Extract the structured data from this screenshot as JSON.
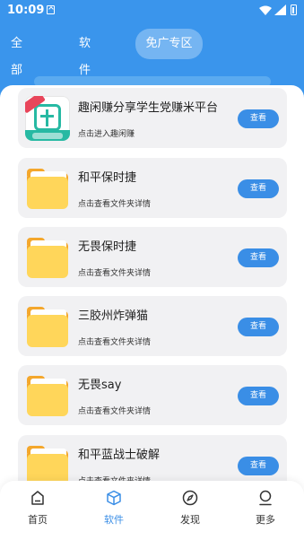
{
  "status_bar": {
    "time": "10:09"
  },
  "tabs": [
    {
      "label": "全部资源",
      "active": false
    },
    {
      "label": "软件库端",
      "active": false
    },
    {
      "label": "免广专区",
      "active": true
    }
  ],
  "cards": [
    {
      "title": "趣闲赚分享学生党赚米平台",
      "subtitle": "点击进入趣闲赚",
      "button": "查看",
      "icon": "app-icon"
    },
    {
      "title": "和平保时捷",
      "subtitle": "点击查看文件夹详情",
      "button": "查看",
      "icon": "folder-icon"
    },
    {
      "title": "无畏保时捷",
      "subtitle": "点击查看文件夹详情",
      "button": "查看",
      "icon": "folder-icon"
    },
    {
      "title": "三胶州炸弹猫",
      "subtitle": "点击查看文件夹详情",
      "button": "查看",
      "icon": "folder-icon"
    },
    {
      "title": "无畏say",
      "subtitle": "点击查看文件夹详情",
      "button": "查看",
      "icon": "folder-icon"
    },
    {
      "title": "和平蓝战士破解",
      "subtitle": "点击查看文件夹详情",
      "button": "查看",
      "icon": "folder-icon"
    }
  ],
  "bottom_nav": [
    {
      "label": "首页",
      "icon": "home-icon",
      "active": false
    },
    {
      "label": "软件",
      "icon": "box-icon",
      "active": true
    },
    {
      "label": "发现",
      "icon": "compass-icon",
      "active": false
    },
    {
      "label": "更多",
      "icon": "user-icon",
      "active": false
    }
  ],
  "colors": {
    "primary": "#3a95ec",
    "button": "#3a8ee6",
    "folder": "#ffd65a"
  }
}
